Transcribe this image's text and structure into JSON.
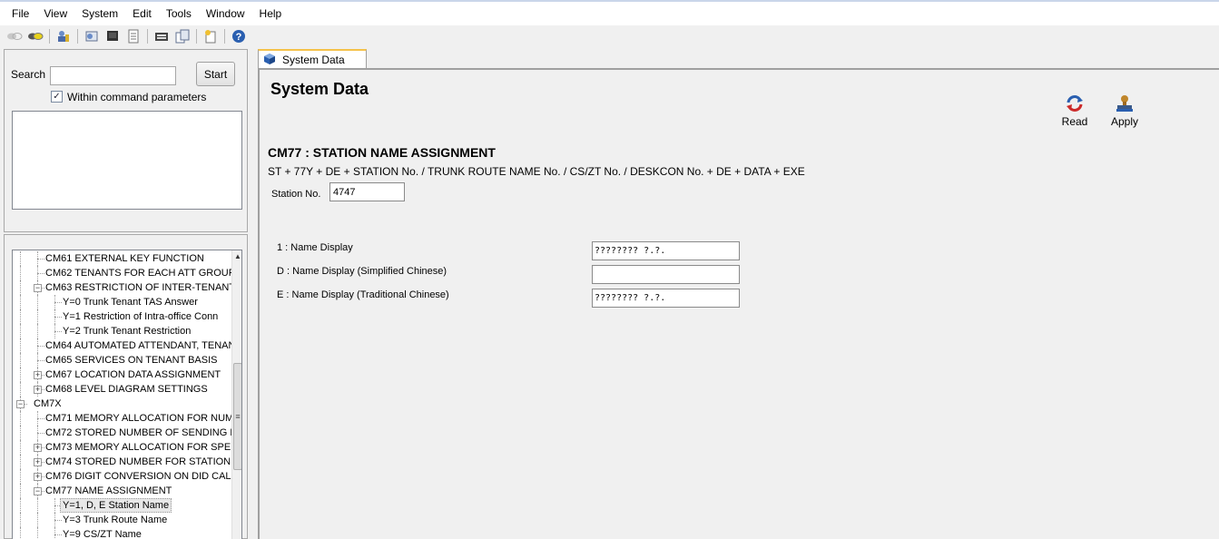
{
  "menubar": {
    "items": [
      "File",
      "View",
      "System",
      "Edit",
      "Tools",
      "Window",
      "Help"
    ]
  },
  "toolbar": {
    "icons": [
      "disconnect-icon",
      "connect-icon",
      "user-key-icon",
      "database-icon",
      "terminal-icon",
      "document-icon",
      "keyboard-icon",
      "copy-icon",
      "new-window-icon",
      "help-icon"
    ]
  },
  "search": {
    "label": "Search",
    "value": "",
    "start_button": "Start",
    "within_checked": true,
    "within_label": "Within command parameters"
  },
  "tree": {
    "rows": [
      {
        "text": "CM61 EXTERNAL KEY FUNCTION",
        "level": 2,
        "expander": "",
        "selected": false
      },
      {
        "text": "CM62 TENANTS FOR EACH ATT GROUP",
        "level": 2,
        "expander": "",
        "selected": false
      },
      {
        "text": "CM63 RESTRICTION OF INTER-TENANT",
        "level": 2,
        "expander": "-",
        "selected": false
      },
      {
        "text": "Y=0 Trunk Tenant TAS  Answer",
        "level": 3,
        "expander": "",
        "selected": false
      },
      {
        "text": "Y=1 Restriction of Intra-office Conn",
        "level": 3,
        "expander": "",
        "selected": false
      },
      {
        "text": "Y=2 Trunk Tenant Restriction",
        "level": 3,
        "expander": "",
        "selected": false
      },
      {
        "text": "CM64 AUTOMATED ATTENDANT, TENAN",
        "level": 2,
        "expander": "",
        "selected": false
      },
      {
        "text": "CM65 SERVICES ON TENANT BASIS",
        "level": 2,
        "expander": "",
        "selected": false
      },
      {
        "text": "CM67 LOCATION DATA ASSIGNMENT",
        "level": 2,
        "expander": "+",
        "selected": false
      },
      {
        "text": "CM68 LEVEL DIAGRAM SETTINGS",
        "level": 2,
        "expander": "+",
        "selected": false
      },
      {
        "text": "CM7X",
        "level": 1,
        "expander": "-",
        "selected": false
      },
      {
        "text": "CM71 MEMORY ALLOCATION FOR NUME",
        "level": 2,
        "expander": "",
        "selected": false
      },
      {
        "text": "CM72 STORED NUMBER OF SENDING DE",
        "level": 2,
        "expander": "",
        "selected": false
      },
      {
        "text": "CM73 MEMORY ALLOCATION FOR SPEE",
        "level": 2,
        "expander": "+",
        "selected": false
      },
      {
        "text": "CM74 STORED NUMBER FOR STATION S",
        "level": 2,
        "expander": "+",
        "selected": false
      },
      {
        "text": "CM76 DIGIT CONVERSION ON DID CALL",
        "level": 2,
        "expander": "+",
        "selected": false
      },
      {
        "text": "CM77 NAME ASSIGNMENT",
        "level": 2,
        "expander": "-",
        "selected": false
      },
      {
        "text": "Y=1, D, E Station Name",
        "level": 3,
        "expander": "",
        "selected": true
      },
      {
        "text": "Y=3 Trunk Route Name",
        "level": 3,
        "expander": "",
        "selected": false
      },
      {
        "text": "Y=9 CS/ZT Name",
        "level": 3,
        "expander": "",
        "selected": false
      }
    ]
  },
  "tabs": [
    {
      "label": "System Data",
      "active": true
    }
  ],
  "main": {
    "page_title": "System Data",
    "read_label": "Read",
    "apply_label": "Apply",
    "command_title": "CM77 : STATION NAME ASSIGNMENT",
    "command_syntax": "ST + 77Y + DE + STATION No. / TRUNK ROUTE NAME No. / CS/ZT No. / DESKCON No. + DE + DATA + EXE",
    "station_label": "Station No.",
    "station_value": "4747",
    "fields": [
      {
        "label": "1 : Name Display",
        "value": "???????? ?.?."
      },
      {
        "label": "D : Name Display (Simplified Chinese)",
        "value": ""
      },
      {
        "label": "E : Name Display (Traditional Chinese)",
        "value": "???????? ?.?."
      }
    ]
  },
  "colors": {
    "tab_accent": "#f5c24a",
    "read_icon": "#cc2a2a",
    "apply_icon": "#2a5fb0"
  }
}
